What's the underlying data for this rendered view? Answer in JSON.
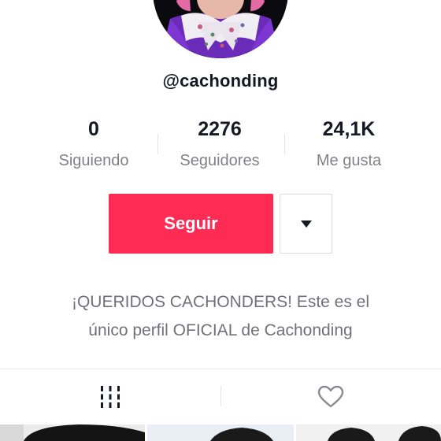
{
  "profile": {
    "username": "@cachonding",
    "avatar_icon": "profile-photo"
  },
  "stats": {
    "following_count": "0",
    "following_label": "Siguiendo",
    "followers_count": "2276",
    "followers_label": "Seguidores",
    "likes_count": "24,1K",
    "likes_label": "Me gusta"
  },
  "actions": {
    "follow_label": "Seguir",
    "more_icon": "caret-down-icon",
    "accent_color": "#fe2c55"
  },
  "bio": {
    "line1": "¡QUERIDOS CACHONDERS! Este es el",
    "line2": "único perfil OFICIAL de Cachonding"
  },
  "tabs": {
    "videos_icon": "grid-icon",
    "liked_icon": "heart-outline-icon"
  },
  "grid": {
    "thumb_count": 3
  }
}
